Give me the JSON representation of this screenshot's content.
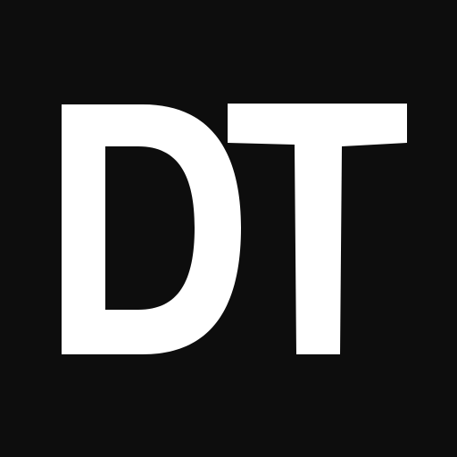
{
  "logo": {
    "text": "DT",
    "colors": {
      "background": "#0d0d0d",
      "foreground": "#ffffff"
    }
  }
}
